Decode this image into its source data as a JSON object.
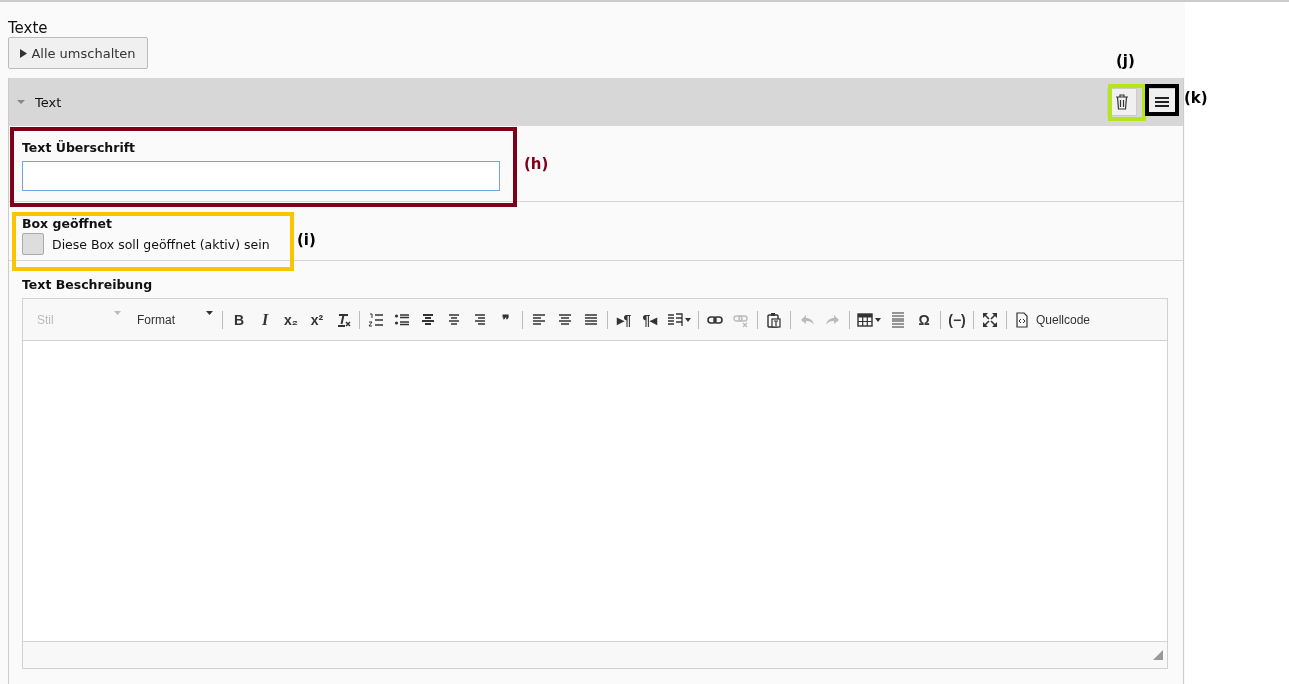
{
  "section": {
    "title": "Texte",
    "toggle_button": "Alle umschalten"
  },
  "panel": {
    "title": "Text",
    "expanded": true,
    "fields": [
      {
        "kind": "text",
        "label": "Text Überschrift"
      },
      {
        "kind": "checkbox",
        "label": "Box geöffnet",
        "option": "Diese Box soll geöffnet (aktiv) sein",
        "checked": false
      },
      {
        "kind": "richtext",
        "label": "Text Beschreibung",
        "toolbar": [
          [
            {
              "kind": "dropdown",
              "label": "Stil",
              "disabled": true
            },
            {
              "kind": "dropdown",
              "label": "Format",
              "disabled": false
            }
          ],
          [
            {
              "kind": "glyph",
              "glyph": "B",
              "disabled": false
            },
            {
              "kind": "glyph",
              "glyph": "I",
              "disabled": false
            },
            {
              "kind": "glyph",
              "glyph": "x₂",
              "disabled": false
            },
            {
              "kind": "glyph",
              "glyph": "x²",
              "disabled": false
            },
            {
              "kind": "icon",
              "disabled": false
            }
          ],
          [
            {
              "kind": "icon",
              "disabled": false
            },
            {
              "kind": "icon",
              "disabled": false
            },
            {
              "kind": "icon",
              "disabled": false
            },
            {
              "kind": "icon",
              "disabled": false
            },
            {
              "kind": "icon",
              "disabled": false
            },
            {
              "kind": "glyph",
              "glyph": "❞",
              "disabled": false
            }
          ],
          [
            {
              "kind": "icon",
              "disabled": false
            },
            {
              "kind": "icon",
              "disabled": false
            },
            {
              "kind": "icon",
              "disabled": false
            }
          ],
          [
            {
              "kind": "glyph",
              "glyph": "▸¶",
              "disabled": false
            },
            {
              "kind": "glyph",
              "glyph": "¶◂",
              "disabled": false
            },
            {
              "kind": "icon",
              "disabled": false,
              "dropdown": true
            }
          ],
          [
            {
              "kind": "icon",
              "disabled": false
            },
            {
              "kind": "icon",
              "disabled": true
            }
          ],
          [
            {
              "kind": "icon",
              "disabled": false
            }
          ],
          [
            {
              "kind": "icon",
              "disabled": true
            },
            {
              "kind": "icon",
              "disabled": true
            }
          ],
          [
            {
              "kind": "icon",
              "disabled": false,
              "dropdown": true
            },
            {
              "kind": "icon",
              "disabled": false
            },
            {
              "kind": "glyph",
              "glyph": "Ω",
              "disabled": false
            }
          ],
          [
            {
              "kind": "glyph",
              "glyph": "(−)",
              "disabled": false
            }
          ],
          [
            {
              "kind": "icon",
              "disabled": false
            }
          ],
          [
            {
              "kind": "icon",
              "disabled": false,
              "label": "Quellcode"
            }
          ]
        ]
      }
    ]
  },
  "annotations": [
    {
      "label": "(h)",
      "color": "#7f0019"
    },
    {
      "label": "(i)",
      "color": "#f7c600"
    },
    {
      "label": "(j)",
      "color": "#b5e61d"
    },
    {
      "label": "(k)",
      "color": "#000000"
    }
  ]
}
